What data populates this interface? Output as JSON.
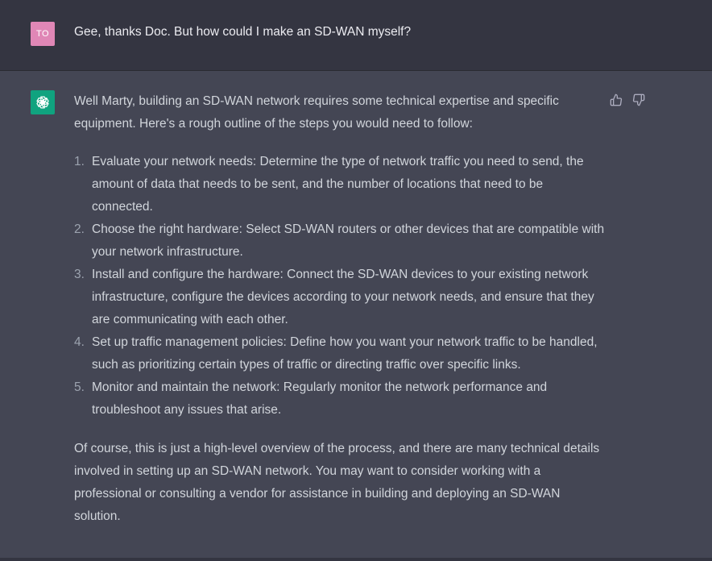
{
  "user_message": {
    "avatar_initials": "TO",
    "avatar_color": "#e087b6",
    "text": "Gee, thanks Doc. But how could I make an SD-WAN myself?"
  },
  "assistant_message": {
    "avatar_icon": "openai-logo-icon",
    "avatar_color": "#10a37f",
    "intro": "Well Marty, building an SD-WAN network requires some technical expertise and specific equipment. Here's a rough outline of the steps you would need to follow:",
    "steps": [
      {
        "num": "1.",
        "text": "Evaluate your network needs: Determine the type of network traffic you need to send, the amount of data that needs to be sent, and the number of locations that need to be connected."
      },
      {
        "num": "2.",
        "text": "Choose the right hardware: Select SD-WAN routers or other devices that are compatible with your network infrastructure."
      },
      {
        "num": "3.",
        "text": "Install and configure the hardware: Connect the SD-WAN devices to your existing network infrastructure, configure the devices according to your network needs, and ensure that they are communicating with each other."
      },
      {
        "num": "4.",
        "text": "Set up traffic management policies: Define how you want your network traffic to be handled, such as prioritizing certain types of traffic or directing traffic over specific links."
      },
      {
        "num": "5.",
        "text": "Monitor and maintain the network: Regularly monitor the network performance and troubleshoot any issues that arise."
      }
    ],
    "outro": "Of course, this is just a high-level overview of the process, and there are many technical details involved in setting up an SD-WAN network. You may want to consider working with a professional or consulting a vendor for assistance in building and deploying an SD-WAN solution."
  },
  "feedback": {
    "thumbs_up_icon": "thumbs-up-icon",
    "thumbs_down_icon": "thumbs-down-icon"
  },
  "colors": {
    "user_bg": "#343541",
    "assistant_bg": "#444654",
    "text": "#d1d5db",
    "list_number": "#9ca3af"
  }
}
